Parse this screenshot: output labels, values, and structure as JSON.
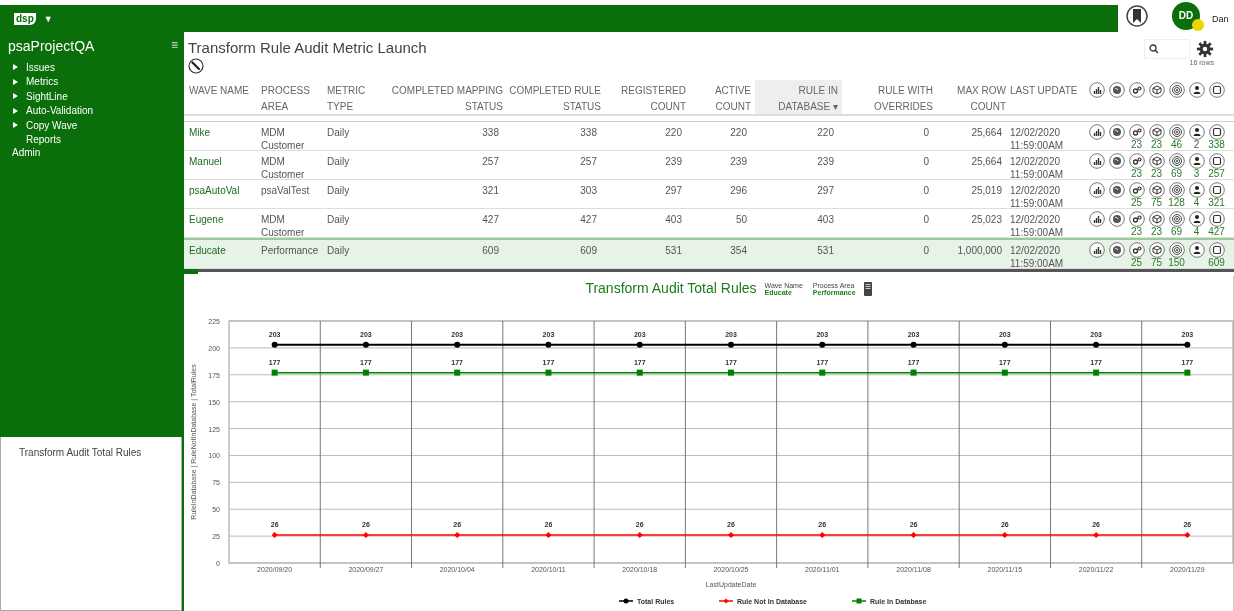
{
  "header": {
    "logo": "dsp",
    "menu_caret": "▼",
    "avatar_initials": "DD",
    "user_name": "Dan"
  },
  "sidebar": {
    "title": "psaProjectQA",
    "menu_glyph": "≡",
    "items": [
      {
        "label": "Issues",
        "expandable": true
      },
      {
        "label": "Metrics",
        "expandable": true
      },
      {
        "label": "SightLine",
        "expandable": true
      },
      {
        "label": "Auto-Validation",
        "expandable": true
      },
      {
        "label": "Copy Wave",
        "expandable": true
      },
      {
        "label": "Reports",
        "expandable": false
      }
    ],
    "footer_items": [
      {
        "label": "Admin"
      }
    ],
    "panel_link": "Transform Audit Total Rules"
  },
  "page": {
    "title": "Transform Rule Audit Metric Launch",
    "row_count": "16 rows"
  },
  "table": {
    "columns": [
      {
        "label": "WAVE NAME",
        "kind": "text",
        "sorted": false
      },
      {
        "label": "PROCESS AREA",
        "kind": "text",
        "sorted": false
      },
      {
        "label": "METRIC TYPE",
        "kind": "text",
        "sorted": false
      },
      {
        "label": "COMPLETED MAPPING STATUS",
        "kind": "number",
        "sorted": false
      },
      {
        "label": "COMPLETED RULE STATUS",
        "kind": "number",
        "sorted": false
      },
      {
        "label": "REGISTERED COUNT",
        "kind": "number",
        "sorted": false
      },
      {
        "label": "ACTIVE COUNT",
        "kind": "number",
        "sorted": false
      },
      {
        "label": "RULE IN DATABASE ▾",
        "kind": "number",
        "sorted": true
      },
      {
        "label": "RULE WITH OVERRIDES",
        "kind": "number",
        "sorted": false
      },
      {
        "label": "MAX ROW COUNT",
        "kind": "number",
        "sorted": false
      },
      {
        "label": "LAST UPDATE",
        "kind": "text",
        "sorted": false
      }
    ],
    "rows": [
      {
        "selected": false,
        "cells": [
          "Mike",
          "MDM Customer",
          "Daily",
          "338",
          "338",
          "220",
          "220",
          "220",
          "0",
          "25,664",
          "12/02/2020 11:59:00AM"
        ],
        "counts": {
          "gears": "23",
          "cube": "23",
          "target": "46",
          "person": "2",
          "square": "338"
        }
      },
      {
        "selected": false,
        "cells": [
          "Manuel",
          "MDM Customer",
          "Daily",
          "257",
          "257",
          "239",
          "239",
          "239",
          "0",
          "25,664",
          "12/02/2020 11:59:00AM"
        ],
        "counts": {
          "gears": "23",
          "cube": "23",
          "target": "69",
          "person": "3",
          "square": "257"
        }
      },
      {
        "selected": false,
        "cells": [
          "psaAutoVal",
          "psaValTest",
          "Daily",
          "321",
          "303",
          "297",
          "296",
          "297",
          "0",
          "25,019",
          "12/02/2020 11:59:00AM"
        ],
        "counts": {
          "gears": "25",
          "cube": "75",
          "target": "128",
          "person": "4",
          "square": "321"
        }
      },
      {
        "selected": false,
        "cells": [
          "Eugene",
          "MDM Customer",
          "Daily",
          "427",
          "427",
          "403",
          "50",
          "403",
          "0",
          "25,023",
          "12/02/2020 11:59:00AM"
        ],
        "counts": {
          "gears": "23",
          "cube": "23",
          "target": "69",
          "person": "4",
          "square": "427"
        }
      },
      {
        "selected": true,
        "cells": [
          "Educate",
          "Performance",
          "Daily",
          "609",
          "609",
          "531",
          "354",
          "531",
          "0",
          "1,000,000",
          "12/02/2020 11:59:00AM"
        ],
        "counts": {
          "gears": "25",
          "cube": "75",
          "target": "150",
          "square": "609"
        }
      }
    ]
  },
  "chart_panel": {
    "title": "Transform Audit Total Rules",
    "filters": [
      {
        "label": "Wave Name",
        "value": "Educate"
      },
      {
        "label": "Process Area",
        "value": "Performance"
      }
    ],
    "chart_data": {
      "type": "line",
      "xlabel": "LastUpdateDate",
      "ylabel": "RuleInDatabase | RuleNotInDatabase | TotalRules",
      "categories": [
        "2020/09/20",
        "2020/09/27",
        "2020/10/04",
        "2020/10/11",
        "2020/10/18",
        "2020/10/25",
        "2020/11/01",
        "2020/11/08",
        "2020/11/15",
        "2020/11/22",
        "2020/11/29"
      ],
      "series": [
        {
          "name": "Total Rules",
          "color": "#000000",
          "marker": "circle",
          "values": [
            203,
            203,
            203,
            203,
            203,
            203,
            203,
            203,
            203,
            203,
            203
          ]
        },
        {
          "name": "Rule Not In Database",
          "color": "#ff0000",
          "marker": "diamond",
          "values": [
            26,
            26,
            26,
            26,
            26,
            26,
            26,
            26,
            26,
            26,
            26
          ]
        },
        {
          "name": "Rule In Database",
          "color": "#008000",
          "marker": "square",
          "values": [
            177,
            177,
            177,
            177,
            177,
            177,
            177,
            177,
            177,
            177,
            177
          ]
        }
      ],
      "ylim": [
        0,
        225
      ],
      "yticks": [
        0,
        25,
        50,
        75,
        100,
        125,
        150,
        175,
        200,
        225
      ],
      "data_labels": true,
      "grid": true,
      "legend": true
    }
  }
}
